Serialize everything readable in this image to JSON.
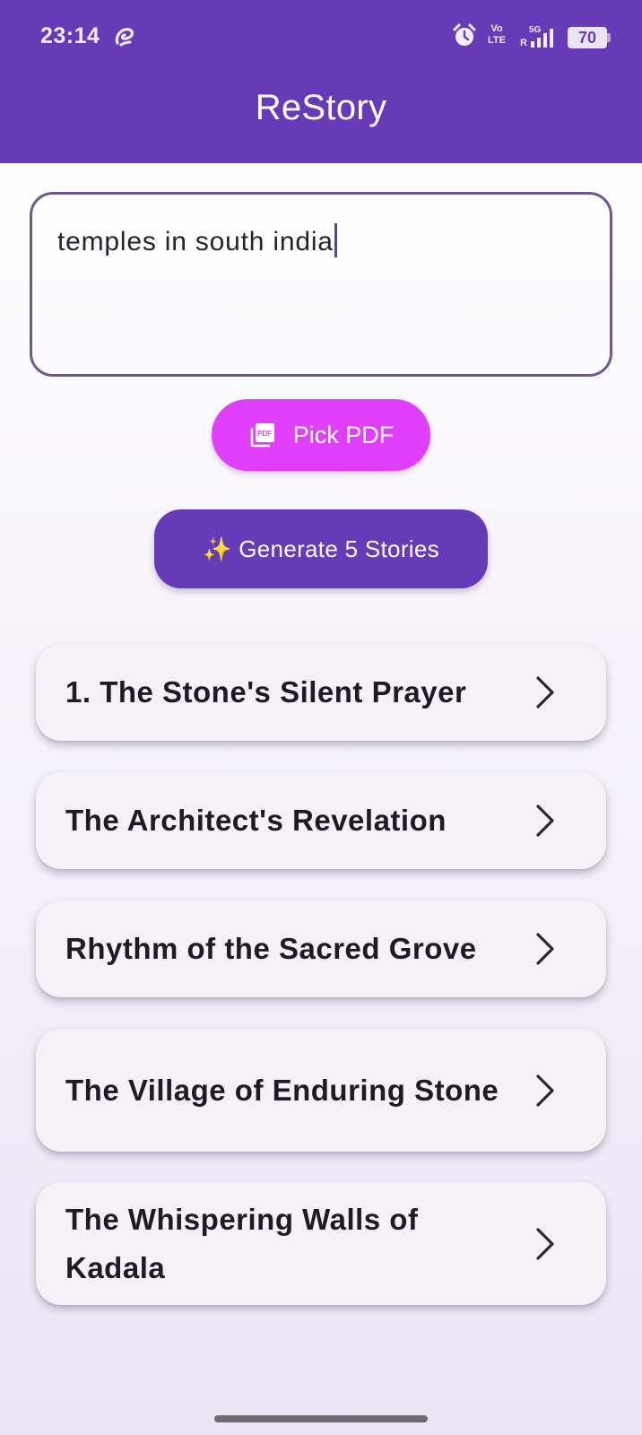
{
  "status_bar": {
    "time": "23:14",
    "network_top": "Vo",
    "network_bottom": "LTE",
    "network_type": "5G",
    "sim_label": "R",
    "battery": "70"
  },
  "app": {
    "title": "ReStory",
    "accent": "#673ab7"
  },
  "input": {
    "value": "temples in south india"
  },
  "buttons": {
    "pick_pdf_label": "Pick PDF",
    "pick_pdf_color": "#e040fb",
    "generate_label": "✨ Generate 5 Stories"
  },
  "stories": [
    {
      "title": "1. The Stone's Silent Prayer"
    },
    {
      "title": "The Architect's Revelation"
    },
    {
      "title": "Rhythm of the Sacred Grove"
    },
    {
      "title": "The Village of Enduring Stone"
    },
    {
      "title": "The Whispering Walls of Kadala"
    }
  ]
}
